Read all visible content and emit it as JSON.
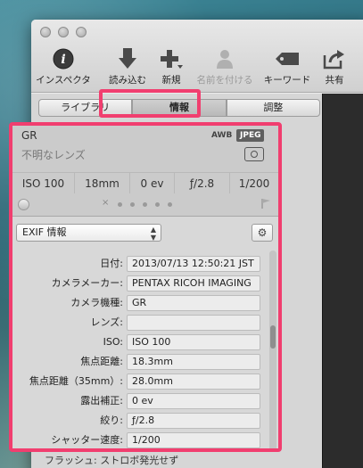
{
  "toolbar": {
    "items": [
      {
        "label": "インスペクタ",
        "icon": "info-icon"
      },
      {
        "label": "読み込む",
        "icon": "import-arrow-icon"
      },
      {
        "label": "新規",
        "icon": "plus-icon"
      },
      {
        "label": "名前を付ける",
        "icon": "person-icon"
      },
      {
        "label": "キーワード",
        "icon": "tag-icon"
      },
      {
        "label": "共有",
        "icon": "share-icon"
      }
    ]
  },
  "tabs": [
    {
      "label": "ライブラリ"
    },
    {
      "label": "情報"
    },
    {
      "label": "調整"
    }
  ],
  "summary": {
    "camera": "GR",
    "lens": "不明なレンズ",
    "white_balance": "AWB",
    "format": "JPEG",
    "iso": "ISO 100",
    "focal_length": "18mm",
    "exposure_bias": "0 ev",
    "aperture": "ƒ/2.8",
    "shutter": "1/200",
    "rating_reject": "×"
  },
  "preset": {
    "selected": "EXIF 情報",
    "gear_label": "⚙"
  },
  "fields": [
    {
      "label": "日付:",
      "value": "2013/07/13 12:50:21 JST"
    },
    {
      "label": "カメラメーカー:",
      "value": "PENTAX RICOH IMAGING"
    },
    {
      "label": "カメラ機種:",
      "value": "GR"
    },
    {
      "label": "レンズ:",
      "value": ""
    },
    {
      "label": "ISO:",
      "value": "ISO 100"
    },
    {
      "label": "焦点距離:",
      "value": "18.3mm"
    },
    {
      "label": "焦点距離（35mm）:",
      "value": "28.0mm"
    },
    {
      "label": "露出補正:",
      "value": "0 ev"
    },
    {
      "label": "絞り:",
      "value": "ƒ/2.8"
    },
    {
      "label": "シャッター速度:",
      "value": "1/200"
    }
  ],
  "cut_row": "フラッシュ:    ストロボ発光せず",
  "colors": {
    "highlight": "#f13e6f"
  }
}
